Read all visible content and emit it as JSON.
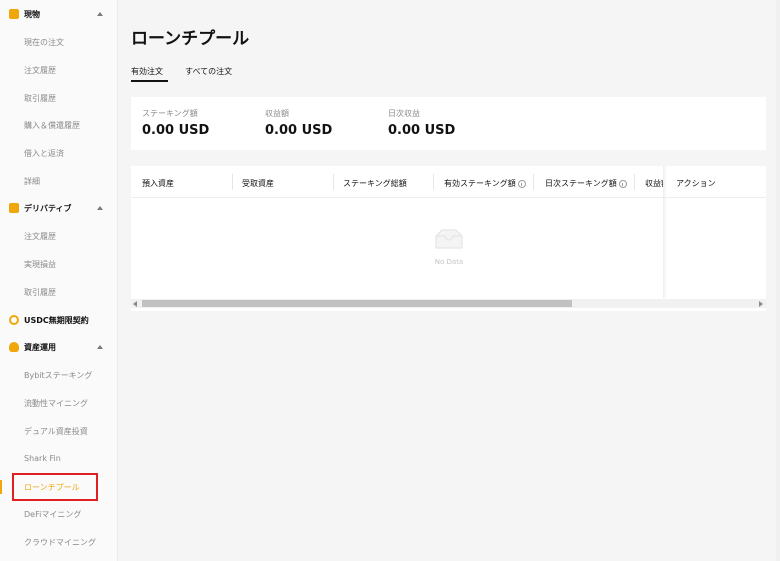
{
  "sidebar": {
    "sections": [
      {
        "label": "現物",
        "icon": "spot-coin-icon",
        "items": [
          "現在の注文",
          "注文履歴",
          "取引履歴",
          "購入＆償還履歴",
          "借入と返済",
          "詳細"
        ]
      },
      {
        "label": "デリバティブ",
        "icon": "derivatives-icon",
        "items": [
          "注文履歴",
          "実現損益",
          "取引履歴"
        ]
      },
      {
        "label": "USDC無期限契約",
        "icon": "usdc-coin-icon",
        "items": []
      },
      {
        "label": "資産運用",
        "icon": "asset-management-icon",
        "items": [
          "Bybitステーキング",
          "流動性マイニング",
          "デュアル資産投資",
          "Shark Fin",
          "ローンチプール",
          "DeFiマイニング",
          "クラウドマイニング"
        ]
      }
    ],
    "active_item": "ローンチプール"
  },
  "main": {
    "title": "ローンチプール",
    "tabs": [
      {
        "label": "有効注文",
        "active": true
      },
      {
        "label": "すべての注文",
        "active": false
      }
    ],
    "stats": [
      {
        "label": "ステーキング額",
        "value": "0.00 USD"
      },
      {
        "label": "収益額",
        "value": "0.00 USD"
      },
      {
        "label": "日次収益",
        "value": "0.00 USD"
      }
    ],
    "table": {
      "columns": [
        "預入資産",
        "受取資産",
        "ステーキング総額",
        "有効ステーキング額",
        "日次ステーキング額",
        "収益額",
        "アクション"
      ],
      "empty_text": "No Data"
    }
  },
  "colors": {
    "accent": "#f0a70a",
    "highlight_border": "#e02020",
    "text_primary": "#121214",
    "text_secondary": "#8a8a8a"
  }
}
